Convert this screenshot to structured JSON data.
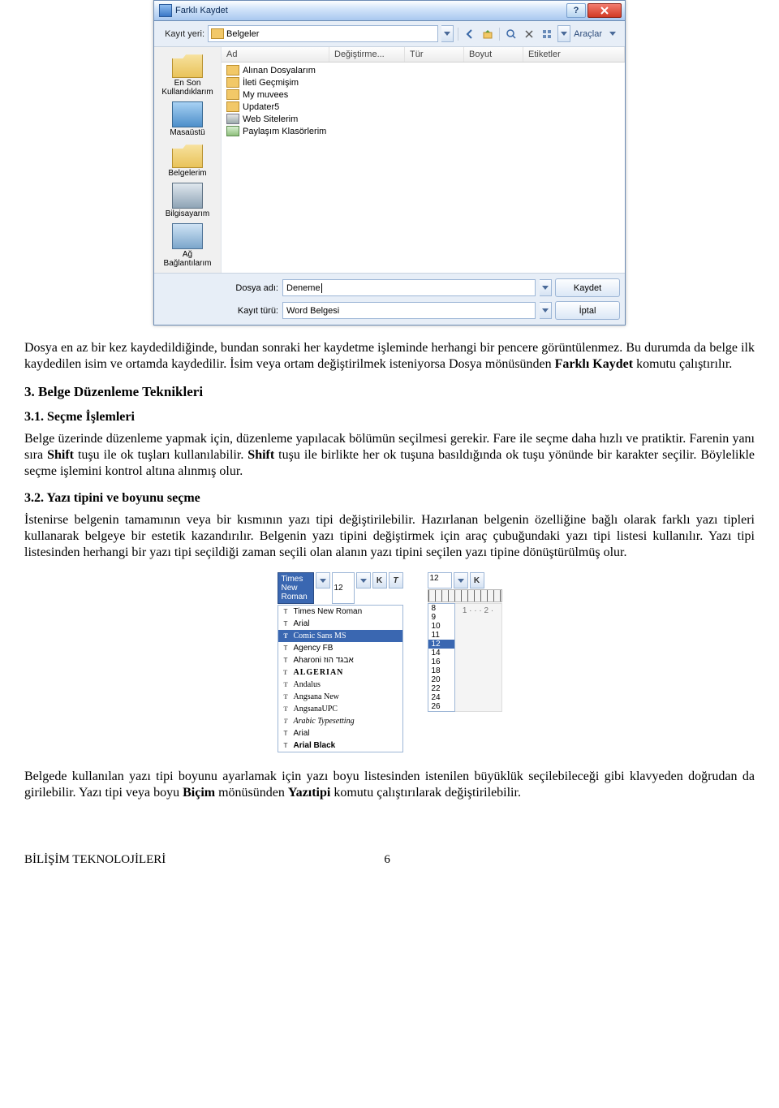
{
  "saveas": {
    "title": "Farklı Kaydet",
    "location_label": "Kayıt yeri:",
    "location_value": "Belgeler",
    "tools_label": "Araçlar",
    "columns": {
      "name": "Ad",
      "modified": "Değiştirme...",
      "type": "Tür",
      "size": "Boyut",
      "tags": "Etiketler"
    },
    "places": {
      "recent": "En Son Kullandıklarım",
      "desktop": "Masaüstü",
      "documents": "Belgelerim",
      "computer": "Bilgisayarım",
      "network": "Ağ Bağlantılarım"
    },
    "files": [
      "Alınan Dosyalarım",
      "İleti Geçmişim",
      "My muvees",
      "Updater5",
      "Web Sitelerim",
      "Paylaşım Klasörlerim"
    ],
    "filename_label": "Dosya adı:",
    "filename_value": "Deneme",
    "filetype_label": "Kayıt türü:",
    "filetype_value": "Word Belgesi",
    "btn_save": "Kaydet",
    "btn_cancel": "İptal",
    "help_symbol": "?",
    "close_symbol": "X"
  },
  "text": {
    "p1a": "Dosya en az bir kez kaydedildiğinde, bundan sonraki her kaydetme işleminde herhangi bir pencere görüntülenmez. Bu durumda da belge ilk kaydedilen isim ve ortamda kaydedilir. İsim veya ortam değiştirilmek isteniyorsa Dosya mönüsünden ",
    "p1b": "Farklı Kaydet",
    "p1c": " komutu çalıştırılır.",
    "h3": "3. Belge Düzenleme Teknikleri",
    "h31": "3.1. Seçme İşlemleri",
    "p2a": "Belge üzerinde düzenleme yapmak için, düzenleme yapılacak bölümün seçilmesi gerekir. Fare ile seçme daha hızlı ve pratiktir. Farenin yanı sıra ",
    "p2b": "Shift",
    "p2c": " tuşu ile ok tuşları kullanılabilir. ",
    "p2d": "Shift",
    "p2e": " tuşu ile birlikte her ok tuşuna basıldığında ok tuşu yönünde bir karakter seçilir. Böylelikle seçme işlemini kontrol altına alınmış olur.",
    "h32": "3.2. Yazı tipini ve boyunu seçme",
    "p3": "İstenirse belgenin tamamının veya bir kısmının yazı tipi değiştirilebilir. Hazırlanan belgenin özelliğine bağlı olarak farklı yazı tipleri kullanarak belgeye bir estetik kazandırılır. Belgenin yazı tipini değiştirmek için araç çubuğundaki yazı tipi listesi kullanılır. Yazı tipi listesinden herhangi bir yazı tipi seçildiği zaman seçili olan alanın yazı tipini seçilen yazı tipine dönüştürülmüş olur.",
    "p4a": "Belgede kullanılan yazı tipi boyunu ayarlamak için yazı boyu listesinden istenilen büyüklük seçilebileceği gibi klavyeden doğrudan da girilebilir. Yazı tipi veya boyu ",
    "p4b": "Biçim",
    "p4c": " mönüsünden ",
    "p4d": "Yazıtipi",
    "p4e": " komutu çalıştırılarak değiştirilebilir."
  },
  "fontlist": {
    "selected": "Times New Roman",
    "size_display": "12",
    "bold_label": "K",
    "italic_label": "T",
    "items": [
      "Times New Roman",
      "Arial",
      "Comic Sans MS",
      "Agency FB",
      "Aharoni אבגד הוז",
      "ALGERIAN",
      "Andalus",
      "Angsana New",
      "AngsanaUPC",
      "Arabic Typesetting",
      "Arial",
      "Arial Black"
    ],
    "selected_index": 2
  },
  "sizelist": {
    "current": "12",
    "bold_label": "K",
    "ruler_marks": "1 · · · 2 ·",
    "sizes": [
      "8",
      "9",
      "10",
      "11",
      "12",
      "14",
      "16",
      "18",
      "20",
      "22",
      "24",
      "26"
    ],
    "selected_index": 4
  },
  "footer": {
    "left": "BİLİŞİM TEKNOLOJİLERİ",
    "page": "6"
  }
}
